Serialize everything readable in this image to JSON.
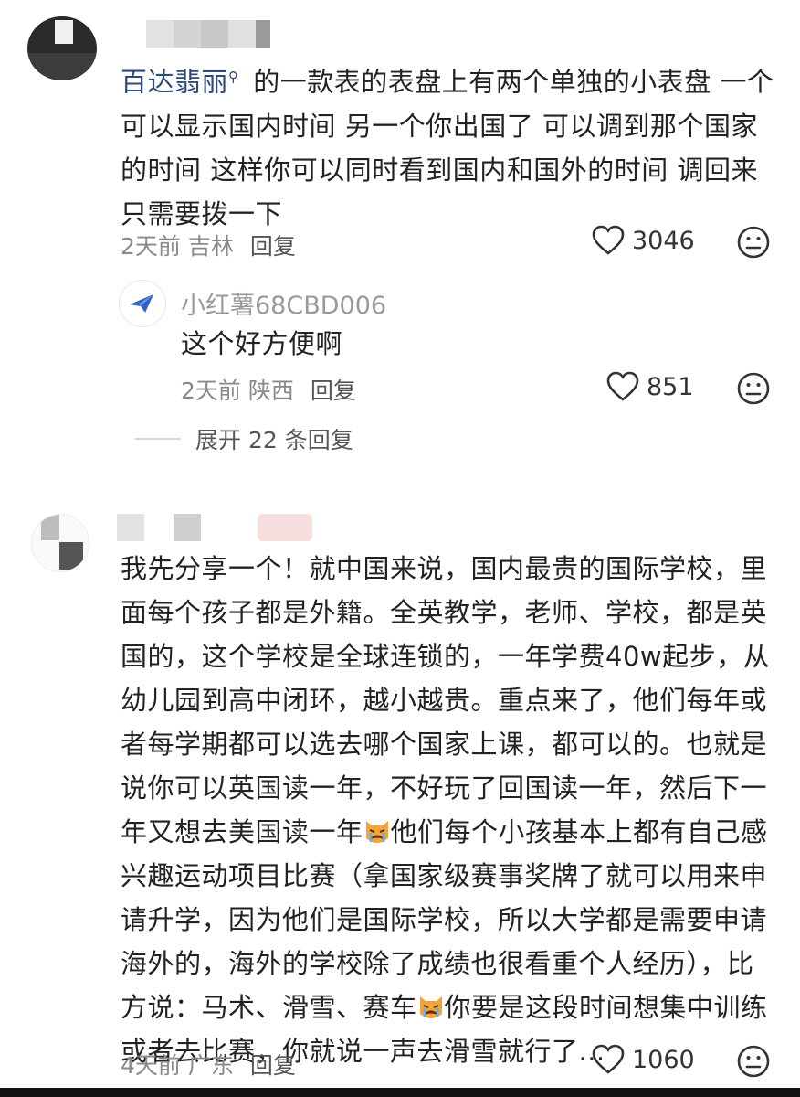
{
  "comments": [
    {
      "mention": "百达翡丽",
      "text_after_mention": " 的一款表的表盘上有两个单独的小表盘 一个可以显示国内时间 另一个你出国了 可以调到那个国家的时间 这样你可以同时看到国内和国外的时间 调回来只需要拨一下",
      "time": "2天前",
      "location": "吉林",
      "reply_label": "回复",
      "likes": "3046",
      "sub_reply": {
        "username": "小红薯68CBD006",
        "text": "这个好方便啊",
        "time": "2天前",
        "location": "陕西",
        "reply_label": "回复",
        "likes": "851"
      },
      "expand_label": "展开 22 条回复"
    },
    {
      "text_part1": "我先分享一个！就中国来说，国内最贵的国际学校，里面每个孩子都是外籍。全英教学，老师、学校，都是英国的，这个学校是全球连锁的，一年学费40w起步，从幼儿园到高中闭环，越小越贵。重点来了，他们每年或者每学期都可以选去哪个国家上课，都可以的。也就是说你可以英国读一年，不好玩了回国读一年，然后下一年又想去美国读一年",
      "text_part2": "他们每个小孩基本上都有自己感兴趣运动项目比赛（拿国家级赛事奖牌了就可以用来申请升学，因为他们是国际学校，所以大学都是需要申请海外的，海外的学校除了成绩也很看重个人经历），比方说：马术、滑雪、赛车",
      "text_part3": "你要是这段时间想集中训练或者去比赛，你就说一声去滑雪就行了...",
      "time": "4天前",
      "location": "广东",
      "reply_label": "回复",
      "likes": "1060"
    }
  ],
  "icons": {
    "like": "heart-outline-icon",
    "dislike": "neutral-face-icon",
    "emoji": "crying-cat-emoji",
    "mention": "search-icon",
    "sub_avatar": "paper-plane-icon"
  }
}
